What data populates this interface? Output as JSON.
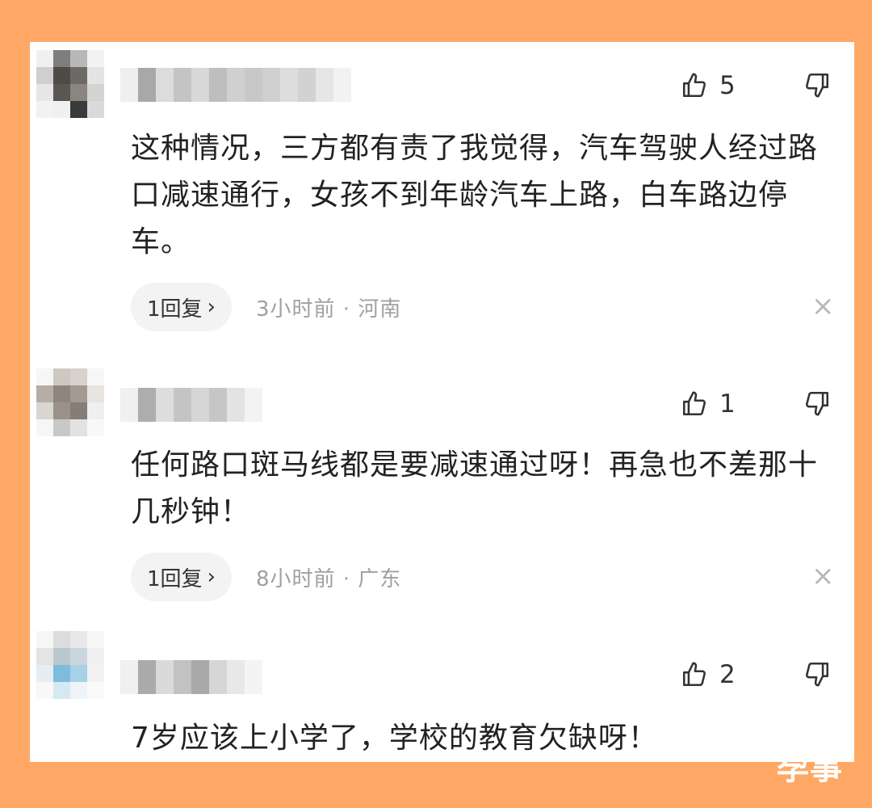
{
  "comments": [
    {
      "likes": "5",
      "text": "这种情况，三方都有责了我觉得，汽车驾驶人经过路口减速通行，女孩不到年龄汽车上路，白车路边停车。",
      "replies": "1回复",
      "reply_chevron": "›",
      "time_location": "3小时前 · 河南",
      "close_symbol": "×"
    },
    {
      "likes": "1",
      "text": "任何路口斑马线都是要减速通过呀！再急也不差那十几秒钟！",
      "replies": "1回复",
      "reply_chevron": "›",
      "time_location": "8小时前 · 广东",
      "close_symbol": "×"
    },
    {
      "likes": "2",
      "text": "7岁应该上小学了，学校的教育欠缺呀！"
    }
  ],
  "watermark": "孕事",
  "colors": {
    "frame": "#FFA866",
    "panel": "#FFFFFF",
    "text": "#222222",
    "meta_text": "#A0A0A0",
    "pill": "#F3F3F3"
  },
  "icons": {
    "like": "thumbs-up-icon",
    "dislike": "thumbs-down-icon",
    "close": "close-icon",
    "reply_more": "chevron-right-icon"
  }
}
